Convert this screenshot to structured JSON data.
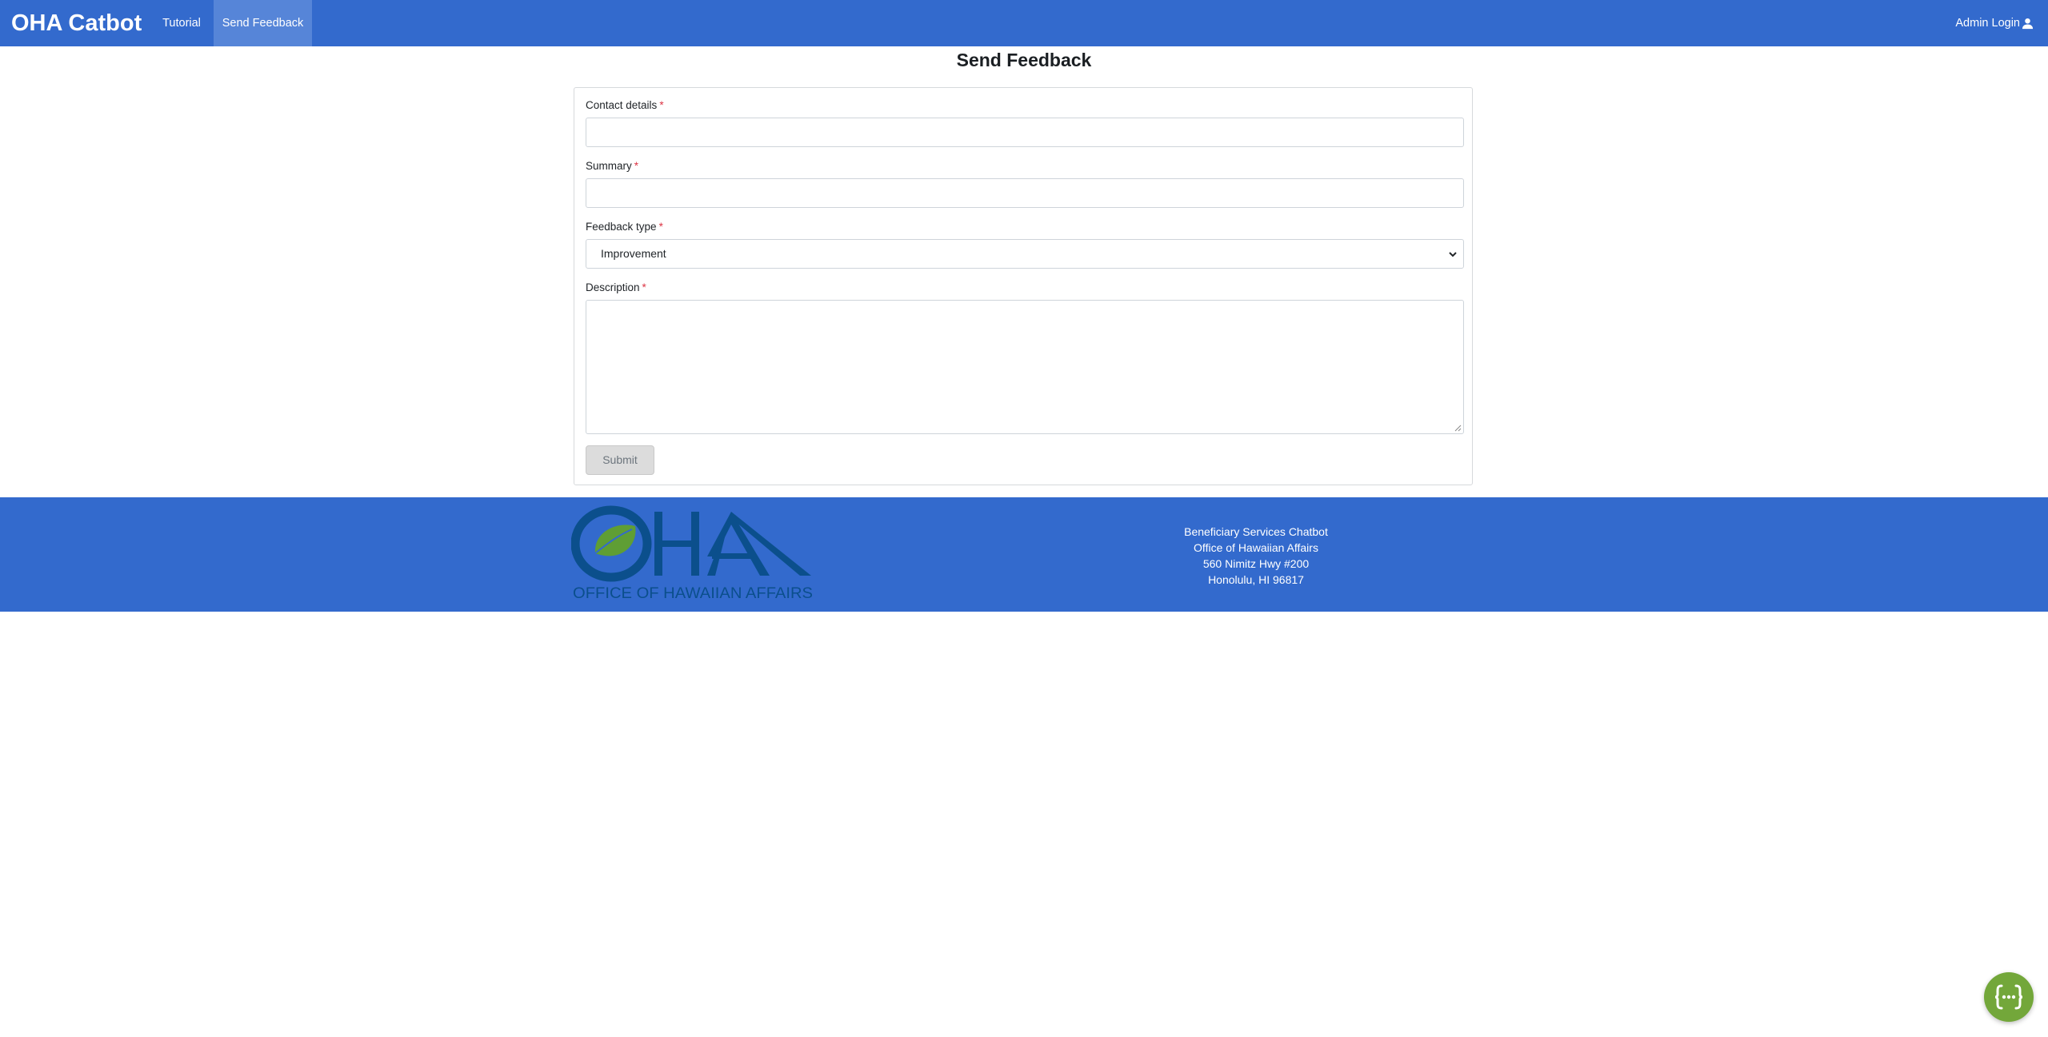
{
  "navbar": {
    "brand": "OHA Catbot",
    "links": [
      {
        "label": "Tutorial"
      },
      {
        "label": "Send Feedback",
        "active": true
      }
    ],
    "admin_login": "Admin Login",
    "admin_icon": "user-icon",
    "color": "#336acd"
  },
  "page": {
    "title": "Send Feedback"
  },
  "form": {
    "contact_label": "Contact details",
    "contact_value": "",
    "summary_label": "Summary",
    "summary_value": "",
    "feedback_type_label": "Feedback type",
    "feedback_type_value": "Improvement",
    "description_label": "Description",
    "description_value": "",
    "required_marker": "*",
    "submit_label": "Submit"
  },
  "footer": {
    "logo_text_main": "OHA",
    "logo_text_sub": "OFFICE OF HAWAIIAN AFFAIRS",
    "info_lines": [
      "Beneficiary Services Chatbot",
      "Office of Hawaiian Affairs",
      "560 Nimitz Hwy #200",
      "Honolulu, HI 96817"
    ]
  },
  "chat_button": {
    "icon": "chat-bubble-icon",
    "color": "#73a73a"
  }
}
